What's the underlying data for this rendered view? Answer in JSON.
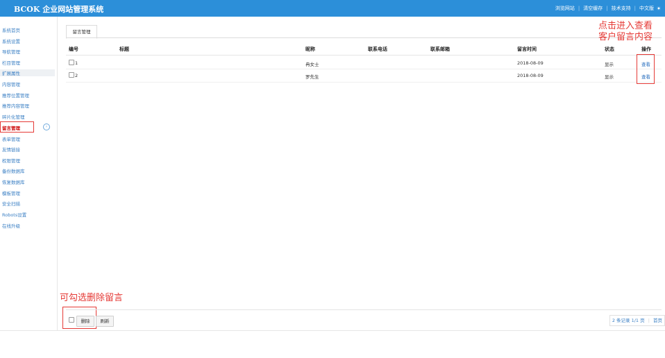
{
  "header": {
    "title": "BCOK 企业网站管理系统",
    "links": [
      "浏览网站",
      "清空缓存",
      "技术支持",
      "中文版"
    ]
  },
  "sidebar": {
    "items": [
      {
        "label": "系统首页"
      },
      {
        "label": "系统设置"
      },
      {
        "label": "导航管理"
      },
      {
        "label": "栏目管理"
      },
      {
        "label": "扩展属性"
      },
      {
        "label": "内容管理"
      },
      {
        "label": "推荐位置管理"
      },
      {
        "label": "推荐内容管理"
      },
      {
        "label": "碎片化管理"
      },
      {
        "label": "留言管理"
      },
      {
        "label": "表单管理"
      },
      {
        "label": "友情链接"
      },
      {
        "label": "权限管理"
      },
      {
        "label": "备份数据库"
      },
      {
        "label": "恢复数据库"
      },
      {
        "label": "模板管理"
      },
      {
        "label": "安全扫描"
      },
      {
        "label": "Robots设置"
      },
      {
        "label": "在线升级"
      }
    ],
    "collapse_icon": "chevron-right-circle-icon"
  },
  "tab": {
    "label": "留言管理"
  },
  "table": {
    "headers": [
      "编号",
      "标题",
      "昵称",
      "联系电话",
      "联系邮箱",
      "留言时间",
      "状态",
      "操作"
    ],
    "rows": [
      {
        "id": "1",
        "title": "",
        "name": "冉女士",
        "phone": "",
        "email": "",
        "time": "2018-08-09",
        "status": "显示",
        "action": "查看"
      },
      {
        "id": "2",
        "title": "",
        "name": "罗先生",
        "phone": "",
        "email": "",
        "time": "2018-08-09",
        "status": "显示",
        "action": "查看"
      }
    ]
  },
  "footer": {
    "delete_label": "删除",
    "refresh_label": "刷新",
    "pager": {
      "records": "2 条记录 1/1 页",
      "first": "首页"
    }
  },
  "annotations": {
    "view_note_line1": "点击进入查看",
    "view_note_line2": "客户留言内容",
    "delete_note": "可勾选删除留言"
  },
  "colors": {
    "header_bg": "#2c8fd9",
    "link": "#3a7fc4",
    "annotation": "#e53935"
  }
}
